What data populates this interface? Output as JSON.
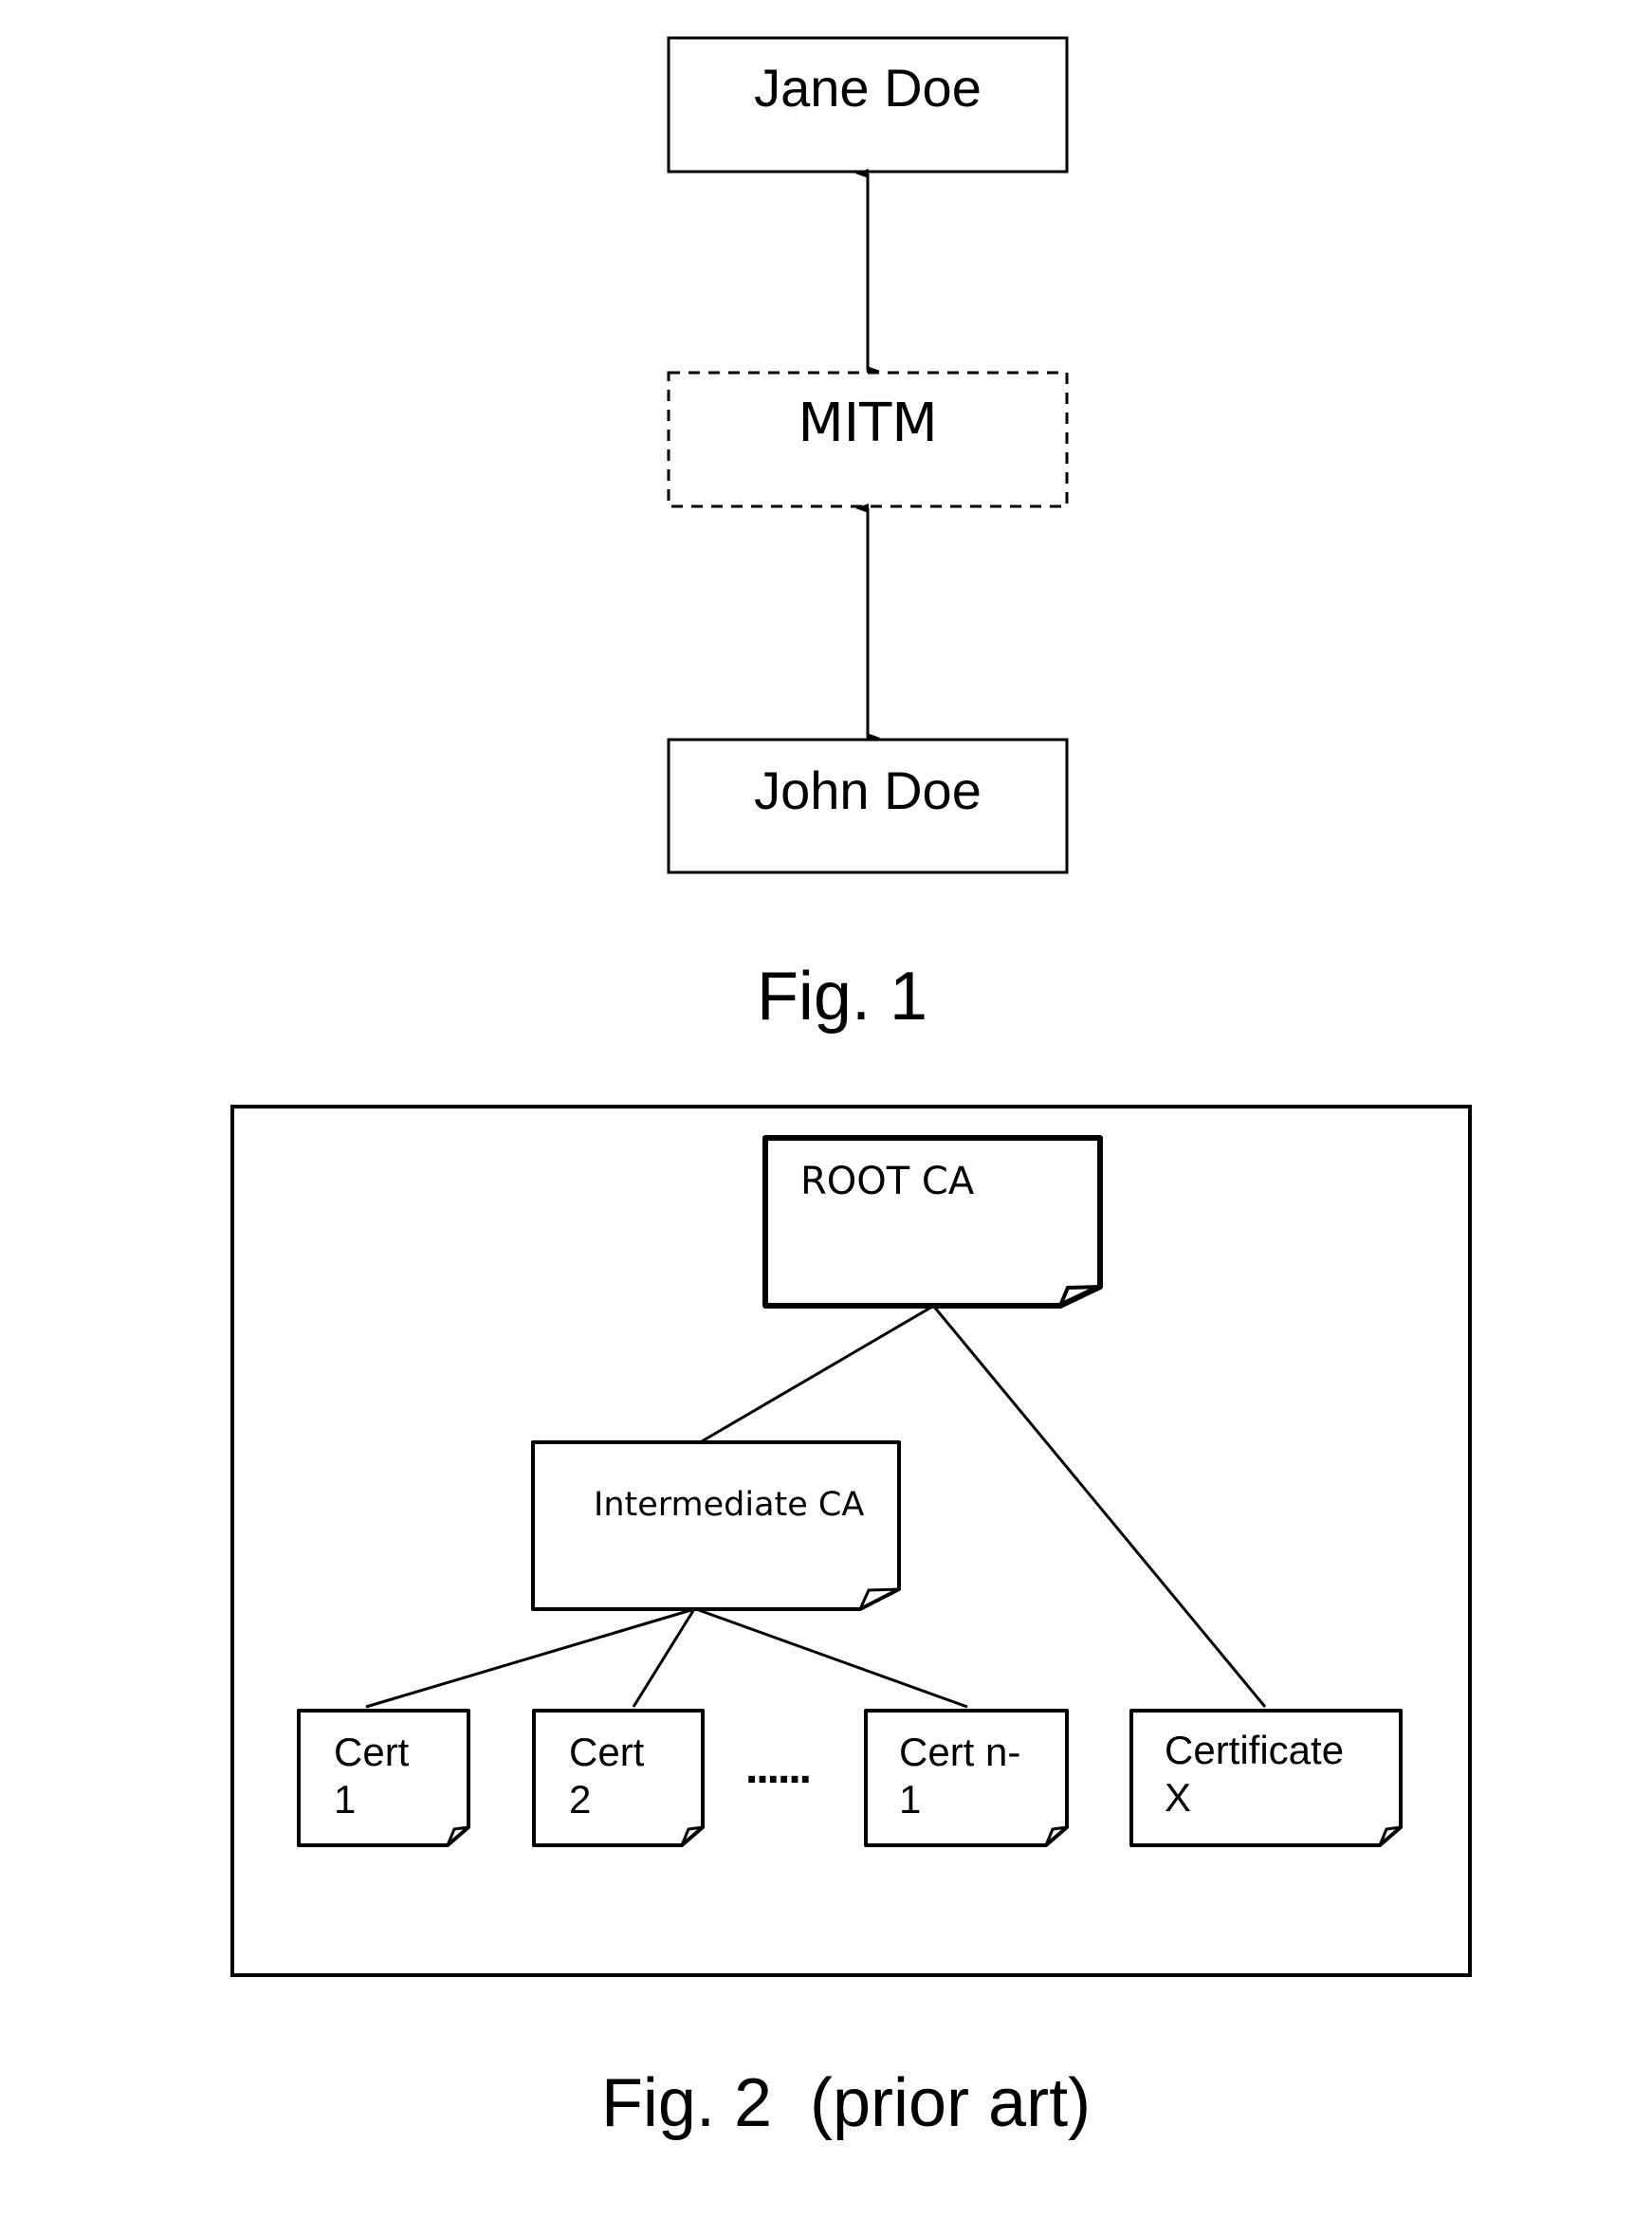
{
  "figure1": {
    "caption": "Fig. 1",
    "nodes": {
      "top": "Jane Doe",
      "middle": "MITM",
      "bottom": "John Doe"
    },
    "connections": [
      {
        "from": "Jane Doe",
        "to": "MITM",
        "type": "bidirectional-arrow"
      },
      {
        "from": "MITM",
        "to": "John Doe",
        "type": "bidirectional-arrow"
      }
    ]
  },
  "figure2": {
    "caption": "Fig. 2  (prior art)",
    "nodes": {
      "root": "ROOT CA",
      "intermediate": "Intermediate CA",
      "cert1": [
        "Cert",
        "1"
      ],
      "cert2": [
        "Cert",
        "2"
      ],
      "certn1": [
        "Cert n-",
        "1"
      ],
      "certx": [
        "Certificate",
        "X"
      ],
      "ellipsis": "......"
    },
    "connections": [
      {
        "from": "ROOT CA",
        "to": "Intermediate CA"
      },
      {
        "from": "ROOT CA",
        "to": "Certificate X"
      },
      {
        "from": "Intermediate CA",
        "to": "Cert 1"
      },
      {
        "from": "Intermediate CA",
        "to": "Cert 2"
      },
      {
        "from": "Intermediate CA",
        "to": "Cert n-1"
      }
    ]
  }
}
